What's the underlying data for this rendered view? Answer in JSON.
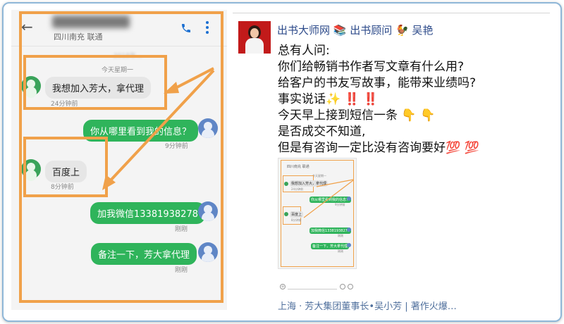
{
  "phone": {
    "contact_sub": "四川南充 联通",
    "date_faint": "2018年…",
    "date_label": "今天星期一",
    "messages": [
      {
        "dir": "in",
        "text": "我想加入芳大，拿代理",
        "time": "24分钟前"
      },
      {
        "dir": "out",
        "text": "你从哪里看到我的信息？",
        "time": "9分钟前"
      },
      {
        "dir": "in",
        "text": "百度上",
        "time": "8分钟前"
      },
      {
        "dir": "out",
        "text": "加我微信13381938278",
        "time": "刚刚"
      },
      {
        "dir": "out",
        "text": "备注一下，芳大拿代理",
        "time": "刚刚"
      }
    ],
    "highlight_color": "#f0a14a",
    "outgoing_bubble_color": "#2fb45b"
  },
  "post": {
    "poster_name": "出书大师网 📚 出书顾问 🐓 吴艳",
    "lines": [
      "总有人问:",
      "你们给畅销书作者写文章有什么用?",
      "给客户的书友写故事，能带来业绩吗?",
      "事实说话✨ ‼️ ‼️",
      "今天早上接到短信一条 👇 👇",
      "是否成交不知道,",
      "但是有咨询一定比没有咨询要好💯 💯"
    ],
    "thumbnail": {
      "sub": "四川南充 联通",
      "date": "今天星期一",
      "messages": [
        {
          "text": "我想加入芳大，拿代理",
          "time": "24分钟前"
        },
        {
          "text": "你从哪里看到我的信息？",
          "time": "9分钟前"
        },
        {
          "text": "百度上",
          "time": "8分钟前"
        },
        {
          "text": "加我微信13381938278",
          "time": "刚刚"
        },
        {
          "text": "备注一下，芳大拿代理",
          "time": "刚刚"
        }
      ]
    },
    "footer": "上海 · 芳大集团董事长•吴小芳 | 著作火爆…",
    "name_color": "#2c4a8a"
  }
}
